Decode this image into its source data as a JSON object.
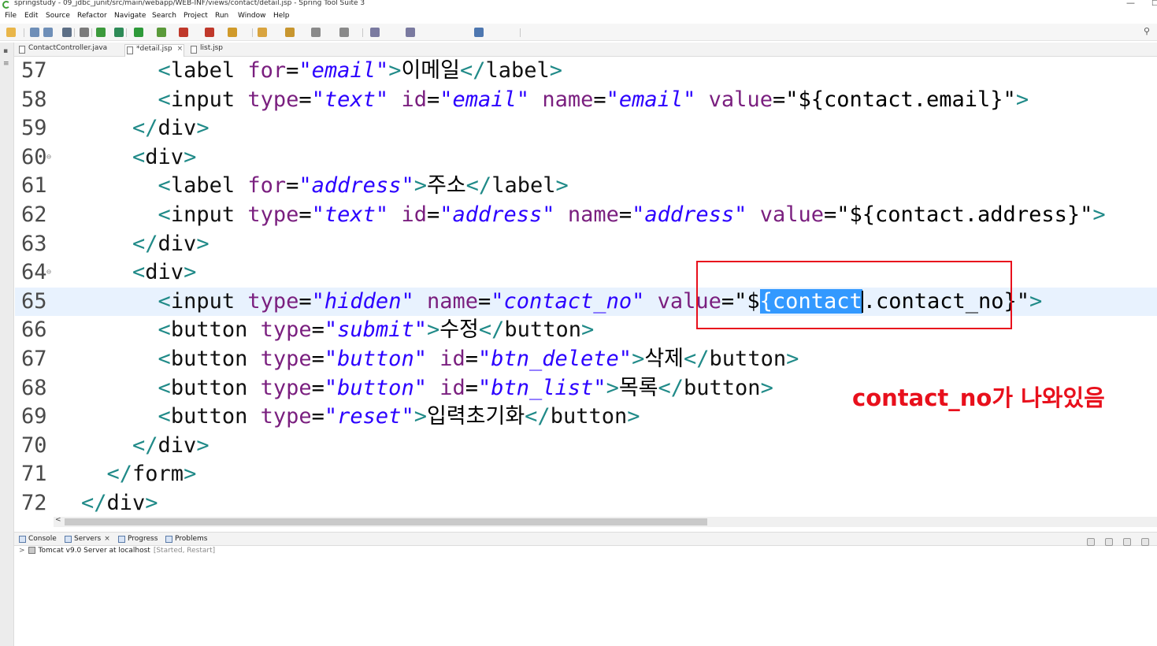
{
  "window": {
    "title": "springstudy - 09_jdbc_junit/src/main/webapp/WEB-INF/views/contact/detail.jsp - Spring Tool Suite 3",
    "minimize_glyph": "—",
    "maximize_glyph": "□"
  },
  "menu": [
    "File",
    "Edit",
    "Source",
    "Refactor",
    "Navigate",
    "Search",
    "Project",
    "Run",
    "Window",
    "Help"
  ],
  "editor_tabs": [
    {
      "label": "ContactController.java",
      "active": false
    },
    {
      "label": "*detail.jsp",
      "active": true,
      "close": "×"
    },
    {
      "label": "list.jsp",
      "active": false
    }
  ],
  "code_lines": [
    {
      "n": "57",
      "parts": [
        [
          "ws",
          "      "
        ],
        [
          "tag",
          "<"
        ],
        [
          "el",
          "label "
        ],
        [
          "attr",
          "for"
        ],
        [
          "txt",
          "="
        ],
        [
          "str",
          "\"email\""
        ],
        [
          "tag",
          ">"
        ],
        [
          "txt",
          "이메일"
        ],
        [
          "tag",
          "</"
        ],
        [
          "el",
          "label"
        ],
        [
          "tag",
          ">"
        ]
      ]
    },
    {
      "n": "58",
      "parts": [
        [
          "ws",
          "      "
        ],
        [
          "tag",
          "<"
        ],
        [
          "el",
          "input "
        ],
        [
          "attr",
          "type"
        ],
        [
          "txt",
          "="
        ],
        [
          "str",
          "\"text\""
        ],
        [
          "txt",
          " "
        ],
        [
          "attr",
          "id"
        ],
        [
          "txt",
          "="
        ],
        [
          "str",
          "\"email\""
        ],
        [
          "txt",
          " "
        ],
        [
          "attr",
          "name"
        ],
        [
          "txt",
          "="
        ],
        [
          "str",
          "\"email\""
        ],
        [
          "txt",
          " "
        ],
        [
          "attr",
          "value"
        ],
        [
          "txt",
          "=\"${contact.email}\""
        ],
        [
          "tag",
          ">"
        ]
      ]
    },
    {
      "n": "59",
      "parts": [
        [
          "ws",
          "    "
        ],
        [
          "tag",
          "</"
        ],
        [
          "el",
          "div"
        ],
        [
          "tag",
          ">"
        ]
      ]
    },
    {
      "n": "60",
      "fold": "⊖",
      "parts": [
        [
          "ws",
          "    "
        ],
        [
          "tag",
          "<"
        ],
        [
          "el",
          "div"
        ],
        [
          "tag",
          ">"
        ]
      ]
    },
    {
      "n": "61",
      "parts": [
        [
          "ws",
          "      "
        ],
        [
          "tag",
          "<"
        ],
        [
          "el",
          "label "
        ],
        [
          "attr",
          "for"
        ],
        [
          "txt",
          "="
        ],
        [
          "str",
          "\"address\""
        ],
        [
          "tag",
          ">"
        ],
        [
          "txt",
          "주소"
        ],
        [
          "tag",
          "</"
        ],
        [
          "el",
          "label"
        ],
        [
          "tag",
          ">"
        ]
      ]
    },
    {
      "n": "62",
      "parts": [
        [
          "ws",
          "      "
        ],
        [
          "tag",
          "<"
        ],
        [
          "el",
          "input "
        ],
        [
          "attr",
          "type"
        ],
        [
          "txt",
          "="
        ],
        [
          "str",
          "\"text\""
        ],
        [
          "txt",
          " "
        ],
        [
          "attr",
          "id"
        ],
        [
          "txt",
          "="
        ],
        [
          "str",
          "\"address\""
        ],
        [
          "txt",
          " "
        ],
        [
          "attr",
          "name"
        ],
        [
          "txt",
          "="
        ],
        [
          "str",
          "\"address\""
        ],
        [
          "txt",
          " "
        ],
        [
          "attr",
          "value"
        ],
        [
          "txt",
          "=\"${contact.address}\""
        ],
        [
          "tag",
          ">"
        ]
      ]
    },
    {
      "n": "63",
      "parts": [
        [
          "ws",
          "    "
        ],
        [
          "tag",
          "</"
        ],
        [
          "el",
          "div"
        ],
        [
          "tag",
          ">"
        ]
      ]
    },
    {
      "n": "64",
      "fold": "⊖",
      "parts": [
        [
          "ws",
          "    "
        ],
        [
          "tag",
          "<"
        ],
        [
          "el",
          "div"
        ],
        [
          "tag",
          ">"
        ]
      ]
    },
    {
      "n": "65",
      "current": true,
      "parts": [
        [
          "ws",
          "      "
        ],
        [
          "tag",
          "<"
        ],
        [
          "el",
          "input "
        ],
        [
          "attr",
          "type"
        ],
        [
          "txt",
          "="
        ],
        [
          "str",
          "\"hidden\""
        ],
        [
          "txt",
          " "
        ],
        [
          "attr",
          "name"
        ],
        [
          "txt",
          "="
        ],
        [
          "str",
          "\"contact_no\""
        ],
        [
          "txt",
          " "
        ],
        [
          "attr",
          "value"
        ],
        [
          "txt",
          "=\"$"
        ],
        [
          "sel",
          "{contact"
        ],
        [
          "caret",
          ""
        ],
        [
          "txt",
          ".contact_no}\""
        ],
        [
          "tag",
          ">"
        ]
      ]
    },
    {
      "n": "66",
      "parts": [
        [
          "ws",
          "      "
        ],
        [
          "tag",
          "<"
        ],
        [
          "el",
          "button "
        ],
        [
          "attr",
          "type"
        ],
        [
          "txt",
          "="
        ],
        [
          "str",
          "\"submit\""
        ],
        [
          "tag",
          ">"
        ],
        [
          "txt",
          "수정"
        ],
        [
          "tag",
          "</"
        ],
        [
          "el",
          "button"
        ],
        [
          "tag",
          ">"
        ]
      ]
    },
    {
      "n": "67",
      "parts": [
        [
          "ws",
          "      "
        ],
        [
          "tag",
          "<"
        ],
        [
          "el",
          "button "
        ],
        [
          "attr",
          "type"
        ],
        [
          "txt",
          "="
        ],
        [
          "str",
          "\"button\""
        ],
        [
          "txt",
          " "
        ],
        [
          "attr",
          "id"
        ],
        [
          "txt",
          "="
        ],
        [
          "str",
          "\"btn_delete\""
        ],
        [
          "tag",
          ">"
        ],
        [
          "txt",
          "삭제"
        ],
        [
          "tag",
          "</"
        ],
        [
          "el",
          "button"
        ],
        [
          "tag",
          ">"
        ]
      ]
    },
    {
      "n": "68",
      "parts": [
        [
          "ws",
          "      "
        ],
        [
          "tag",
          "<"
        ],
        [
          "el",
          "button "
        ],
        [
          "attr",
          "type"
        ],
        [
          "txt",
          "="
        ],
        [
          "str",
          "\"button\""
        ],
        [
          "txt",
          " "
        ],
        [
          "attr",
          "id"
        ],
        [
          "txt",
          "="
        ],
        [
          "str",
          "\"btn_list\""
        ],
        [
          "tag",
          ">"
        ],
        [
          "txt",
          "목록"
        ],
        [
          "tag",
          "</"
        ],
        [
          "el",
          "button"
        ],
        [
          "tag",
          ">"
        ]
      ]
    },
    {
      "n": "69",
      "parts": [
        [
          "ws",
          "      "
        ],
        [
          "tag",
          "<"
        ],
        [
          "el",
          "button "
        ],
        [
          "attr",
          "type"
        ],
        [
          "txt",
          "="
        ],
        [
          "str",
          "\"reset\""
        ],
        [
          "tag",
          ">"
        ],
        [
          "txt",
          "입력초기화"
        ],
        [
          "tag",
          "</"
        ],
        [
          "el",
          "button"
        ],
        [
          "tag",
          ">"
        ]
      ]
    },
    {
      "n": "70",
      "parts": [
        [
          "ws",
          "    "
        ],
        [
          "tag",
          "</"
        ],
        [
          "el",
          "div"
        ],
        [
          "tag",
          ">"
        ]
      ]
    },
    {
      "n": "71",
      "parts": [
        [
          "ws",
          "  "
        ],
        [
          "tag",
          "</"
        ],
        [
          "el",
          "form"
        ],
        [
          "tag",
          ">"
        ]
      ]
    },
    {
      "n": "72",
      "parts": [
        [
          "tag",
          "</"
        ],
        [
          "el",
          "div"
        ],
        [
          "tag",
          ">"
        ]
      ]
    }
  ],
  "annotation": {
    "text": "contact_no가 나와있음",
    "color": "#e8101c"
  },
  "hscroll": {
    "left_arrow": "<"
  },
  "bottom_tabs": [
    {
      "label": "Console",
      "close": ""
    },
    {
      "label": "Servers",
      "close": "×"
    },
    {
      "label": "Progress",
      "close": ""
    },
    {
      "label": "Problems",
      "close": ""
    }
  ],
  "servers": {
    "row_label": "Tomcat v9.0 Server at localhost",
    "status": "[Started, Restart]",
    "expand_glyph": ">"
  },
  "colors": {
    "tag": "#208a88",
    "attribute": "#7a1f7f",
    "string": "#2b00ff",
    "selection": "#3399ff",
    "current_line": "#e8f2fe"
  },
  "icons": {
    "toolbar": [
      "new-icon",
      "save-icon",
      "save-all-icon",
      "print-icon",
      "skip-breakpoints-icon",
      "debug-icon",
      "refresh-icon",
      "run-icon",
      "run-coverage-icon",
      "external-tools-icon",
      "stop-icon",
      "open-type-icon",
      "open-task-icon",
      "search-icon-tb",
      "next-annotation-icon",
      "previous-annotation-icon",
      "back-icon",
      "forward-icon",
      "pin-editor-icon"
    ],
    "search": "⚲"
  }
}
